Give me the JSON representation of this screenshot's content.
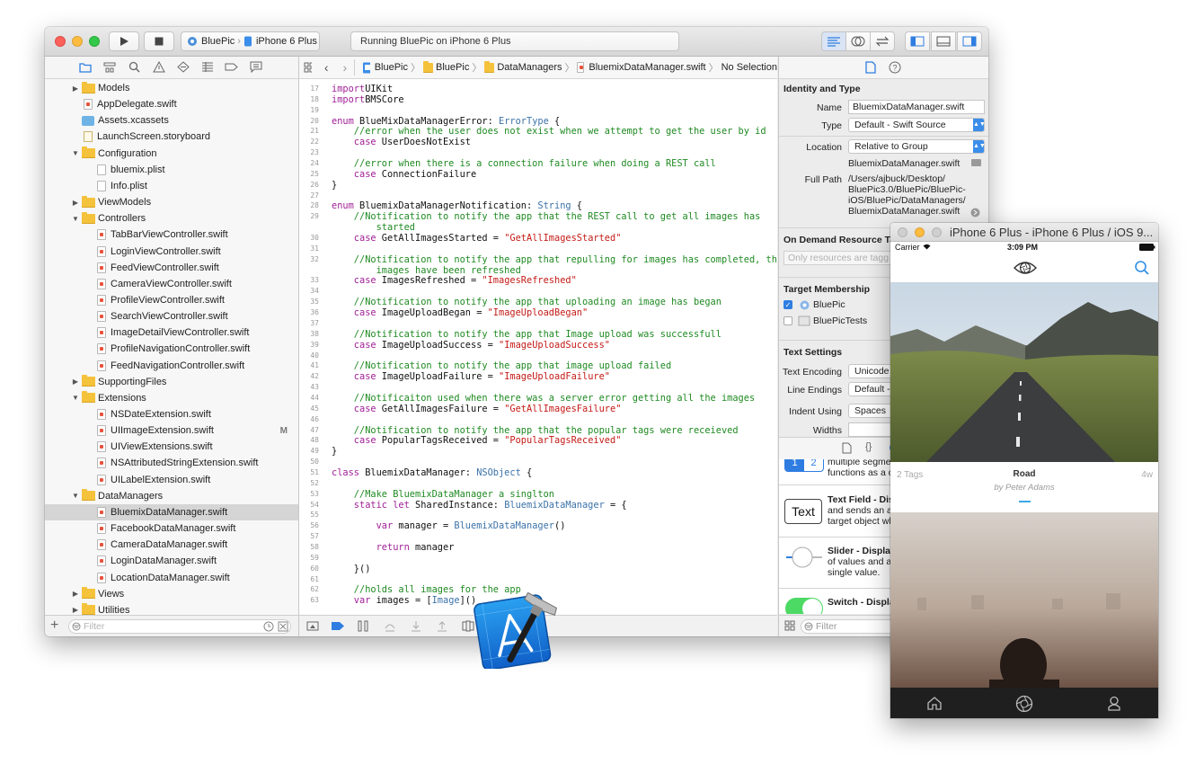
{
  "xcode": {
    "toolbar": {
      "scheme_project": "BluePic",
      "scheme_device": "iPhone 6 Plus",
      "activity": "Running BluePic on iPhone 6 Plus"
    },
    "navigator": {
      "items": [
        {
          "label": "Models",
          "kind": "folder",
          "indent": 1,
          "disclosure": "closed"
        },
        {
          "label": "AppDelegate.swift",
          "kind": "swift",
          "indent": 1
        },
        {
          "label": "Assets.xcassets",
          "kind": "assets",
          "indent": 1
        },
        {
          "label": "LaunchScreen.storyboard",
          "kind": "storyboard",
          "indent": 1
        },
        {
          "label": "Configuration",
          "kind": "folder",
          "indent": 1,
          "disclosure": "open"
        },
        {
          "label": "bluemix.plist",
          "kind": "plist",
          "indent": 2
        },
        {
          "label": "Info.plist",
          "kind": "plist",
          "indent": 2
        },
        {
          "label": "ViewModels",
          "kind": "folder",
          "indent": 1,
          "disclosure": "closed"
        },
        {
          "label": "Controllers",
          "kind": "folder",
          "indent": 1,
          "disclosure": "open"
        },
        {
          "label": "TabBarViewController.swift",
          "kind": "swift",
          "indent": 2
        },
        {
          "label": "LoginViewController.swift",
          "kind": "swift",
          "indent": 2
        },
        {
          "label": "FeedViewController.swift",
          "kind": "swift",
          "indent": 2
        },
        {
          "label": "CameraViewController.swift",
          "kind": "swift",
          "indent": 2
        },
        {
          "label": "ProfileViewController.swift",
          "kind": "swift",
          "indent": 2
        },
        {
          "label": "SearchViewController.swift",
          "kind": "swift",
          "indent": 2
        },
        {
          "label": "ImageDetailViewController.swift",
          "kind": "swift",
          "indent": 2
        },
        {
          "label": "ProfileNavigationController.swift",
          "kind": "swift",
          "indent": 2
        },
        {
          "label": "FeedNavigationController.swift",
          "kind": "swift",
          "indent": 2
        },
        {
          "label": "SupportingFiles",
          "kind": "folder",
          "indent": 1,
          "disclosure": "closed"
        },
        {
          "label": "Extensions",
          "kind": "folder",
          "indent": 1,
          "disclosure": "open"
        },
        {
          "label": "NSDateExtension.swift",
          "kind": "swift",
          "indent": 2
        },
        {
          "label": "UIImageExtension.swift",
          "kind": "swift",
          "indent": 2,
          "badge": "M"
        },
        {
          "label": "UIViewExtensions.swift",
          "kind": "swift",
          "indent": 2
        },
        {
          "label": "NSAttributedStringExtension.swift",
          "kind": "swift",
          "indent": 2
        },
        {
          "label": "UILabelExtension.swift",
          "kind": "swift",
          "indent": 2
        },
        {
          "label": "DataManagers",
          "kind": "folder",
          "indent": 1,
          "disclosure": "open"
        },
        {
          "label": "BluemixDataManager.swift",
          "kind": "swift",
          "indent": 2,
          "selected": true
        },
        {
          "label": "FacebookDataManager.swift",
          "kind": "swift",
          "indent": 2
        },
        {
          "label": "CameraDataManager.swift",
          "kind": "swift",
          "indent": 2
        },
        {
          "label": "LoginDataManager.swift",
          "kind": "swift",
          "indent": 2
        },
        {
          "label": "LocationDataManager.swift",
          "kind": "swift",
          "indent": 2
        },
        {
          "label": "Views",
          "kind": "folder",
          "indent": 1,
          "disclosure": "closed"
        },
        {
          "label": "Utilities",
          "kind": "folder",
          "indent": 1,
          "disclosure": "closed"
        }
      ],
      "filter_placeholder": "Filter"
    },
    "jumpbar": {
      "crumbs": [
        "BluePic",
        "BluePic",
        "DataManagers",
        "BluemixDataManager.swift",
        "No Selection"
      ]
    },
    "code": [
      {
        "n": "17",
        "segs": [
          [
            "kw",
            "import"
          ],
          [
            "",
            "UIKit"
          ]
        ]
      },
      {
        "n": "18",
        "segs": [
          [
            "kw",
            "import"
          ],
          [
            "",
            "BMSCore"
          ]
        ]
      },
      {
        "n": "19",
        "segs": []
      },
      {
        "n": "20",
        "segs": [
          [
            "kw",
            "enum"
          ],
          [
            "",
            " BlueMixDataManagerError: "
          ],
          [
            "ty",
            "ErrorType"
          ],
          [
            "",
            " {"
          ]
        ]
      },
      {
        "n": "21",
        "segs": [
          [
            "cm",
            "    //error when the user does not exist when we attempt to get the user by id"
          ]
        ]
      },
      {
        "n": "22",
        "segs": [
          [
            "kw",
            "    case"
          ],
          [
            "",
            " UserDoesNotExist"
          ]
        ]
      },
      {
        "n": "23",
        "segs": []
      },
      {
        "n": "24",
        "segs": [
          [
            "cm",
            "    //error when there is a connection failure when doing a REST call"
          ]
        ]
      },
      {
        "n": "25",
        "segs": [
          [
            "kw",
            "    case"
          ],
          [
            "",
            " ConnectionFailure"
          ]
        ]
      },
      {
        "n": "26",
        "segs": [
          [
            "",
            "}"
          ]
        ]
      },
      {
        "n": "27",
        "segs": []
      },
      {
        "n": "28",
        "segs": [
          [
            "kw",
            "enum"
          ],
          [
            "",
            " BluemixDataManagerNotification: "
          ],
          [
            "ty",
            "String"
          ],
          [
            "",
            " {"
          ]
        ]
      },
      {
        "n": "29",
        "segs": [
          [
            "cm",
            "    //Notification to notify the app that the REST call to get all images has"
          ]
        ]
      },
      {
        "n": "",
        "segs": [
          [
            "cm",
            "        started"
          ]
        ]
      },
      {
        "n": "30",
        "segs": [
          [
            "kw",
            "    case"
          ],
          [
            "",
            " GetAllImagesStarted = "
          ],
          [
            "st",
            "\"GetAllImagesStarted\""
          ]
        ]
      },
      {
        "n": "31",
        "segs": []
      },
      {
        "n": "32",
        "segs": [
          [
            "cm",
            "    //Notification to notify the app that repulling for images has completed, the"
          ]
        ]
      },
      {
        "n": "",
        "segs": [
          [
            "cm",
            "        images have been refreshed"
          ]
        ]
      },
      {
        "n": "33",
        "segs": [
          [
            "kw",
            "    case"
          ],
          [
            "",
            " ImagesRefreshed = "
          ],
          [
            "st",
            "\"ImagesRefreshed\""
          ]
        ]
      },
      {
        "n": "34",
        "segs": []
      },
      {
        "n": "35",
        "segs": [
          [
            "cm",
            "    //Notification to notify the app that uploading an image has began"
          ]
        ]
      },
      {
        "n": "36",
        "segs": [
          [
            "kw",
            "    case"
          ],
          [
            "",
            " ImageUploadBegan = "
          ],
          [
            "st",
            "\"ImageUploadBegan\""
          ]
        ]
      },
      {
        "n": "37",
        "segs": []
      },
      {
        "n": "38",
        "segs": [
          [
            "cm",
            "    //Notification to notify the app that Image upload was successfull"
          ]
        ]
      },
      {
        "n": "39",
        "segs": [
          [
            "kw",
            "    case"
          ],
          [
            "",
            " ImageUploadSuccess = "
          ],
          [
            "st",
            "\"ImageUploadSuccess\""
          ]
        ]
      },
      {
        "n": "40",
        "segs": []
      },
      {
        "n": "41",
        "segs": [
          [
            "cm",
            "    //Notification to notify the app that image upload failed"
          ]
        ]
      },
      {
        "n": "42",
        "segs": [
          [
            "kw",
            "    case"
          ],
          [
            "",
            " ImageUploadFailure = "
          ],
          [
            "st",
            "\"ImageUploadFailure\""
          ]
        ]
      },
      {
        "n": "43",
        "segs": []
      },
      {
        "n": "44",
        "segs": [
          [
            "cm",
            "    //Notificaiton used when there was a server error getting all the images"
          ]
        ]
      },
      {
        "n": "45",
        "segs": [
          [
            "kw",
            "    case"
          ],
          [
            "",
            " GetAllImagesFailure = "
          ],
          [
            "st",
            "\"GetAllImagesFailure\""
          ]
        ]
      },
      {
        "n": "46",
        "segs": []
      },
      {
        "n": "47",
        "segs": [
          [
            "cm",
            "    //Notification to notify the app that the popular tags were receieved"
          ]
        ]
      },
      {
        "n": "48",
        "segs": [
          [
            "kw",
            "    case"
          ],
          [
            "",
            " PopularTagsReceived = "
          ],
          [
            "st",
            "\"PopularTagsReceived\""
          ]
        ]
      },
      {
        "n": "49",
        "segs": [
          [
            "",
            "}"
          ]
        ]
      },
      {
        "n": "50",
        "segs": []
      },
      {
        "n": "51",
        "segs": [
          [
            "kw",
            "class"
          ],
          [
            "",
            " BluemixDataManager: "
          ],
          [
            "ty",
            "NSObject"
          ],
          [
            "",
            " {"
          ]
        ]
      },
      {
        "n": "52",
        "segs": []
      },
      {
        "n": "53",
        "segs": [
          [
            "cm",
            "    //Make BluemixDataManager a singlton"
          ]
        ]
      },
      {
        "n": "54",
        "segs": [
          [
            "kw",
            "    static let"
          ],
          [
            "",
            " SharedInstance: "
          ],
          [
            "ty",
            "BluemixDataManager"
          ],
          [
            "",
            " = {"
          ]
        ]
      },
      {
        "n": "55",
        "segs": []
      },
      {
        "n": "56",
        "segs": [
          [
            "kw",
            "        var"
          ],
          [
            "",
            " manager = "
          ],
          [
            "ty",
            "BluemixDataManager"
          ],
          [
            "",
            "()"
          ]
        ]
      },
      {
        "n": "57",
        "segs": []
      },
      {
        "n": "58",
        "segs": [
          [
            "kw",
            "        return"
          ],
          [
            "",
            " manager"
          ]
        ]
      },
      {
        "n": "59",
        "segs": []
      },
      {
        "n": "60",
        "segs": [
          [
            "",
            "    }()"
          ]
        ]
      },
      {
        "n": "61",
        "segs": []
      },
      {
        "n": "62",
        "segs": [
          [
            "cm",
            "    //holds all images for the app"
          ]
        ]
      },
      {
        "n": "63",
        "segs": [
          [
            "kw",
            "    var"
          ],
          [
            "",
            " images = ["
          ],
          [
            "ty",
            "Image"
          ],
          [
            "",
            "]()"
          ]
        ]
      }
    ],
    "inspector": {
      "identity_header": "Identity and Type",
      "name_label": "Name",
      "name_value": "BluemixDataManager.swift",
      "type_label": "Type",
      "type_value": "Default - Swift Source",
      "location_label": "Location",
      "location_value": "Relative to Group",
      "location_file": "BluemixDataManager.swift",
      "fullpath_label": "Full Path",
      "fullpath_lines": [
        "/Users/ajbuck/Desktop/",
        "BluePic3.0/BluePic/BluePic-",
        "iOS/BluePic/DataManagers/",
        "BluemixDataManager.swift"
      ],
      "odr_header": "On Demand Resource Tags",
      "odr_placeholder": "Only resources are tagg",
      "target_header": "Target Membership",
      "targets": [
        {
          "label": "BluePic",
          "checked": true
        },
        {
          "label": "BluePicTests",
          "checked": false
        }
      ],
      "text_header": "Text Settings",
      "encoding_label": "Text Encoding",
      "encoding_value": "Unicode",
      "endings_label": "Line Endings",
      "endings_value": "Default -",
      "indent_label": "Indent Using",
      "indent_value": "Spaces",
      "widths_label": "Widths",
      "library": [
        {
          "icon": "1 2",
          "lines": [
            "multiple segmen",
            "functions as a di"
          ]
        },
        {
          "icon": "Text",
          "title": "Text Field",
          "lines": [
            "Text Field - Dis",
            "and sends an ac",
            "target object wh"
          ]
        },
        {
          "icon": "slider",
          "title": "Slider",
          "lines": [
            "Slider - Display",
            "of values and all",
            "single value."
          ]
        },
        {
          "icon": "switch",
          "title": "Switch",
          "lines": [
            "Switch - Displa"
          ]
        }
      ],
      "filter_placeholder": "Filter"
    }
  },
  "simulator": {
    "title": "iPhone 6 Plus - iPhone 6 Plus / iOS 9...",
    "carrier": "Carrier",
    "time": "3:09 PM",
    "photo": {
      "tags": "2 Tags",
      "title": "Road",
      "author": "by Peter Adams",
      "age": "4w"
    }
  },
  "colors": {
    "keyword": "#a01f97",
    "comment": "#1f8a22",
    "string": "#c41a16",
    "type": "#3b72a8",
    "accent": "#2f7de1",
    "selection": "#d5d5d5"
  }
}
